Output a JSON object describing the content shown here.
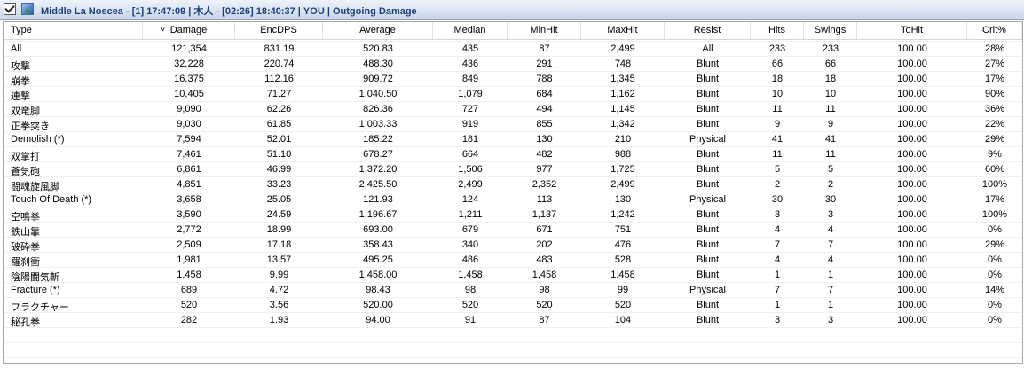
{
  "titlebar": {
    "title": "Middle La Noscea - [1] 17:47:09 | 木人 - [02:26] 18:40:37 | YOU | Outgoing Damage"
  },
  "columns": [
    {
      "key": "type",
      "label": "Type"
    },
    {
      "key": "damage",
      "label": "Damage",
      "sort": "descending"
    },
    {
      "key": "encdps",
      "label": "EncDPS"
    },
    {
      "key": "average",
      "label": "Average"
    },
    {
      "key": "median",
      "label": "Median"
    },
    {
      "key": "minhit",
      "label": "MinHit"
    },
    {
      "key": "maxhit",
      "label": "MaxHit"
    },
    {
      "key": "resist",
      "label": "Resist"
    },
    {
      "key": "hits",
      "label": "Hits"
    },
    {
      "key": "swings",
      "label": "Swings"
    },
    {
      "key": "tohit",
      "label": "ToHit"
    },
    {
      "key": "crit",
      "label": "Crit%"
    }
  ],
  "rows": [
    [
      "All",
      "121,354",
      "831.19",
      "520.83",
      "435",
      "87",
      "2,499",
      "All",
      "233",
      "233",
      "100.00",
      "28%"
    ],
    [
      "攻撃",
      "32,228",
      "220.74",
      "488.30",
      "436",
      "291",
      "748",
      "Blunt",
      "66",
      "66",
      "100.00",
      "27%"
    ],
    [
      "崩拳",
      "16,375",
      "112.16",
      "909.72",
      "849",
      "788",
      "1,345",
      "Blunt",
      "18",
      "18",
      "100.00",
      "17%"
    ],
    [
      "連撃",
      "10,405",
      "71.27",
      "1,040.50",
      "1,079",
      "684",
      "1,162",
      "Blunt",
      "10",
      "10",
      "100.00",
      "90%"
    ],
    [
      "双竜脚",
      "9,090",
      "62.26",
      "826.36",
      "727",
      "494",
      "1,145",
      "Blunt",
      "11",
      "11",
      "100.00",
      "36%"
    ],
    [
      "正拳突き",
      "9,030",
      "61.85",
      "1,003.33",
      "919",
      "855",
      "1,342",
      "Blunt",
      "9",
      "9",
      "100.00",
      "22%"
    ],
    [
      "Demolish (*)",
      "7,594",
      "52.01",
      "185.22",
      "181",
      "130",
      "210",
      "Physical",
      "41",
      "41",
      "100.00",
      "29%"
    ],
    [
      "双掌打",
      "7,461",
      "51.10",
      "678.27",
      "664",
      "482",
      "988",
      "Blunt",
      "11",
      "11",
      "100.00",
      "9%"
    ],
    [
      "蒼気砲",
      "6,861",
      "46.99",
      "1,372.20",
      "1,506",
      "977",
      "1,725",
      "Blunt",
      "5",
      "5",
      "100.00",
      "60%"
    ],
    [
      "闘魂旋風脚",
      "4,851",
      "33.23",
      "2,425.50",
      "2,499",
      "2,352",
      "2,499",
      "Blunt",
      "2",
      "2",
      "100.00",
      "100%"
    ],
    [
      "Touch Of Death (*)",
      "3,658",
      "25.05",
      "121.93",
      "124",
      "113",
      "130",
      "Physical",
      "30",
      "30",
      "100.00",
      "17%"
    ],
    [
      "空鳴拳",
      "3,590",
      "24.59",
      "1,196.67",
      "1,211",
      "1,137",
      "1,242",
      "Blunt",
      "3",
      "3",
      "100.00",
      "100%"
    ],
    [
      "鉄山靠",
      "2,772",
      "18.99",
      "693.00",
      "679",
      "671",
      "751",
      "Blunt",
      "4",
      "4",
      "100.00",
      "0%"
    ],
    [
      "破砕拳",
      "2,509",
      "17.18",
      "358.43",
      "340",
      "202",
      "476",
      "Blunt",
      "7",
      "7",
      "100.00",
      "29%"
    ],
    [
      "羅刹衝",
      "1,981",
      "13.57",
      "495.25",
      "486",
      "483",
      "528",
      "Blunt",
      "4",
      "4",
      "100.00",
      "0%"
    ],
    [
      "陰陽闘気斬",
      "1,458",
      "9.99",
      "1,458.00",
      "1,458",
      "1,458",
      "1,458",
      "Blunt",
      "1",
      "1",
      "100.00",
      "0%"
    ],
    [
      "Fracture (*)",
      "689",
      "4.72",
      "98.43",
      "98",
      "98",
      "99",
      "Physical",
      "7",
      "7",
      "100.00",
      "14%"
    ],
    [
      "フラクチャー",
      "520",
      "3.56",
      "520.00",
      "520",
      "520",
      "520",
      "Blunt",
      "1",
      "1",
      "100.00",
      "0%"
    ],
    [
      "秘孔拳",
      "282",
      "1.93",
      "94.00",
      "91",
      "87",
      "104",
      "Blunt",
      "3",
      "3",
      "100.00",
      "0%"
    ]
  ]
}
